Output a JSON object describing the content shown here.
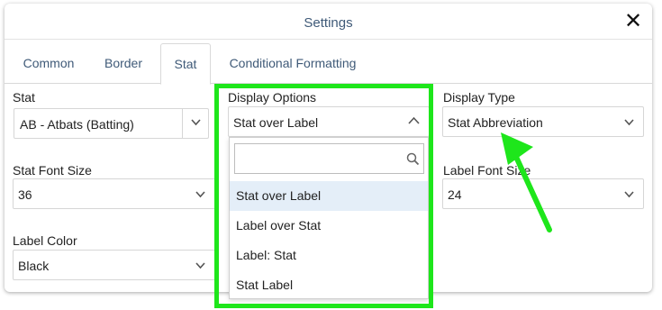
{
  "dialog": {
    "title": "Settings",
    "close_glyph": "✕"
  },
  "tabs": [
    {
      "label": "Common"
    },
    {
      "label": "Border"
    },
    {
      "label": "Stat",
      "active": true
    },
    {
      "label": "Conditional Formatting"
    }
  ],
  "fields": {
    "stat": {
      "label": "Stat",
      "value": "AB - Atbats (Batting)"
    },
    "display_options": {
      "label": "Display Options",
      "value": "Stat over Label"
    },
    "display_type": {
      "label": "Display Type",
      "value": "Stat Abbreviation"
    },
    "stat_font_size": {
      "label": "Stat Font Size",
      "value": "36"
    },
    "label_font_size": {
      "label": "Label Font Size",
      "value": "24"
    },
    "label_color": {
      "label": "Label Color",
      "value": "Black"
    }
  },
  "dropdown": {
    "search_value": "",
    "options": [
      {
        "label": "Stat over Label",
        "selected": true
      },
      {
        "label": "Label over Stat"
      },
      {
        "label": "Label: Stat"
      },
      {
        "label": "Stat Label"
      }
    ]
  },
  "annotation": {
    "highlight_color": "#1ee61b",
    "arrow_color": "#1ee61b"
  },
  "colors": {
    "title_text": "#3f5a78",
    "selected_option_bg": "#e4eef8"
  },
  "icons": {
    "close": "close-icon",
    "chevron_down": "chevron-down-icon",
    "chevron_up": "chevron-up-icon",
    "search": "search-icon"
  }
}
